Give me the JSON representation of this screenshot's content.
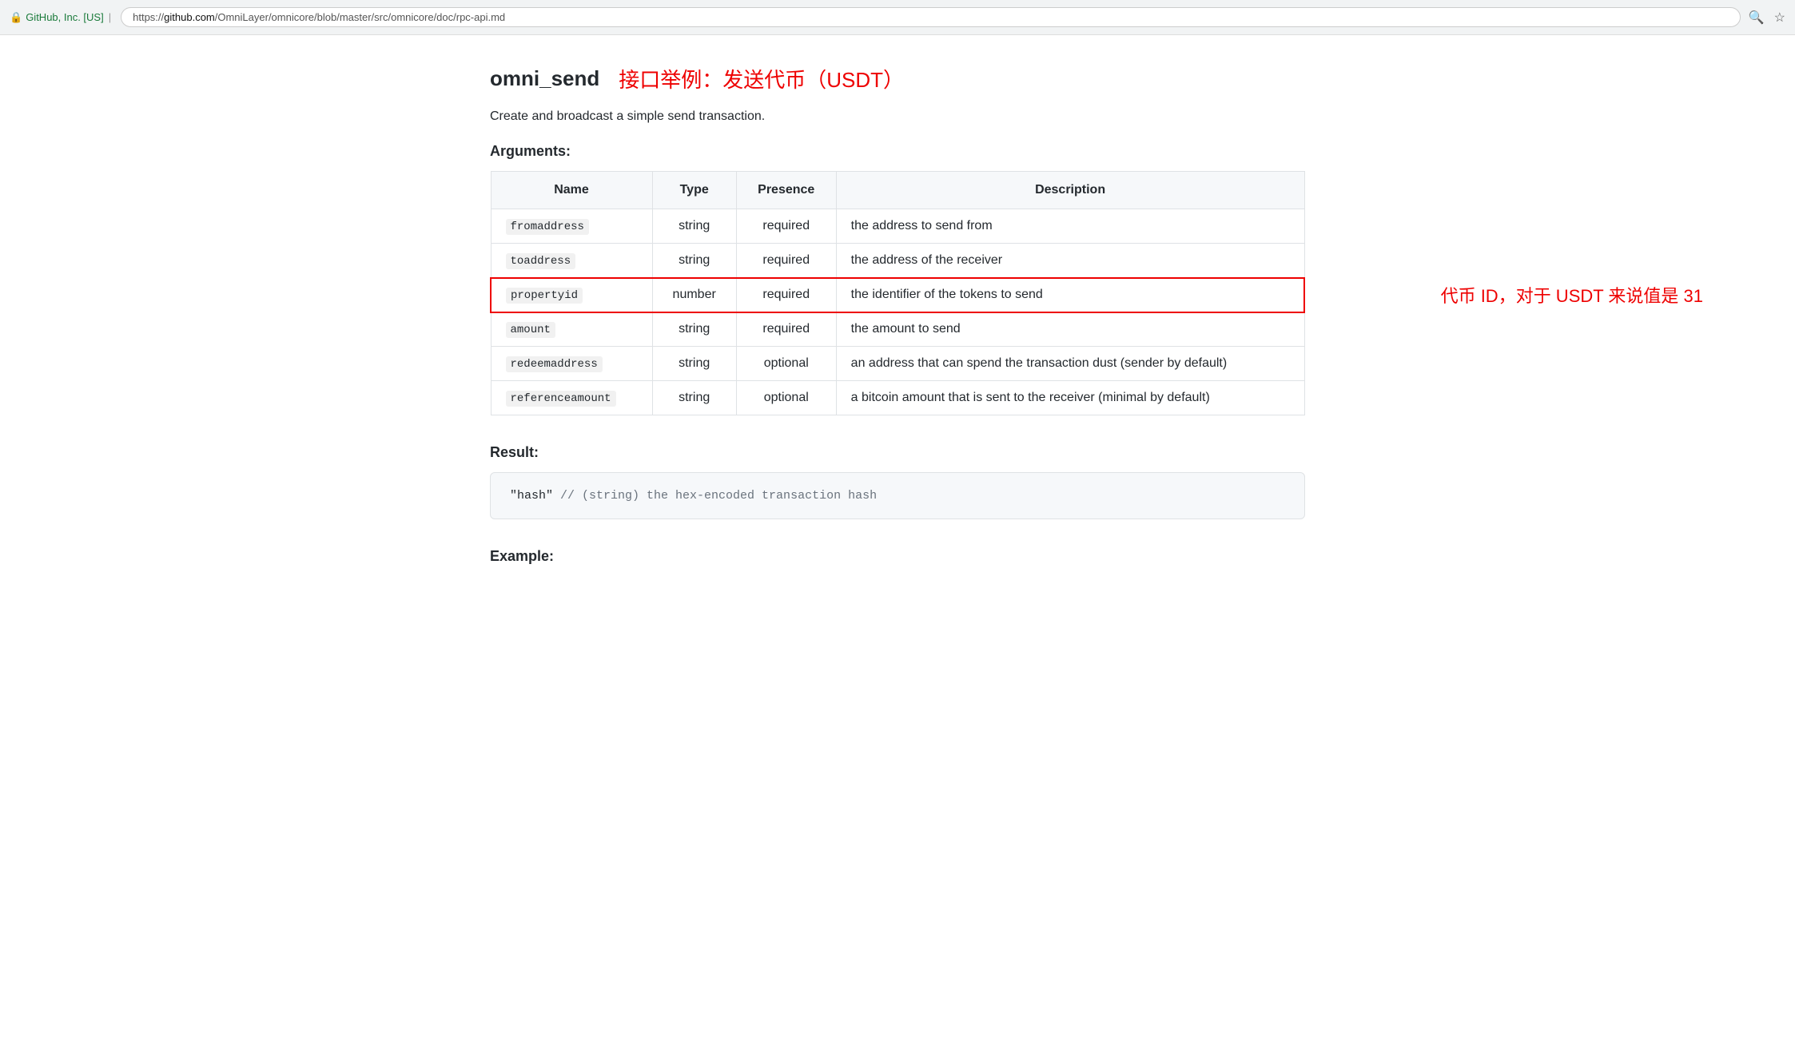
{
  "browser": {
    "security_label": "GitHub, Inc. [US]",
    "url_prefix": "https://",
    "url_domain": "github.com",
    "url_path": "/OmniLayer/omnicore/blob/master/src/omnicore/doc/rpc-api.md",
    "search_icon": "🔍",
    "star_icon": "☆"
  },
  "page": {
    "heading": "omni_send",
    "heading_annotation": "接口举例：发送代币（USDT）",
    "subtitle": "Create and broadcast a simple send transaction.",
    "arguments_label": "Arguments:",
    "result_label": "Result:",
    "example_label": "Example:"
  },
  "table": {
    "headers": [
      "Name",
      "Type",
      "Presence",
      "Description"
    ],
    "rows": [
      {
        "name": "fromaddress",
        "type": "string",
        "presence": "required",
        "description": "the address to send from",
        "highlighted": false
      },
      {
        "name": "toaddress",
        "type": "string",
        "presence": "required",
        "description": "the address of the receiver",
        "highlighted": false
      },
      {
        "name": "propertyid",
        "type": "number",
        "presence": "required",
        "description": "the identifier of the tokens to send",
        "highlighted": true,
        "annotation": "代币 ID，对于 USDT 来说值是 31"
      },
      {
        "name": "amount",
        "type": "string",
        "presence": "required",
        "description": "the amount to send",
        "highlighted": false
      },
      {
        "name": "redeemaddress",
        "type": "string",
        "presence": "optional",
        "description": "an address that can spend the transaction dust (sender by default)",
        "highlighted": false
      },
      {
        "name": "referenceamount",
        "type": "string",
        "presence": "optional",
        "description": "a bitcoin amount that is sent to the receiver (minimal by default)",
        "highlighted": false
      }
    ]
  },
  "result": {
    "code": "\"hash\"  // (string) the hex-encoded transaction hash"
  }
}
